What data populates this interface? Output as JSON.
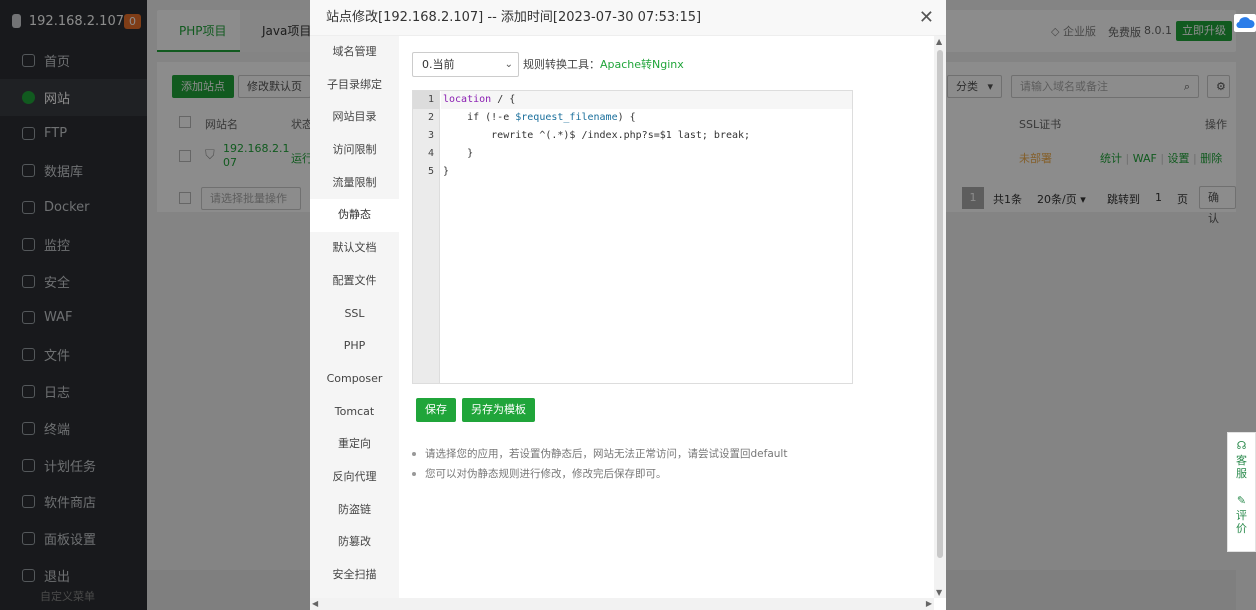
{
  "sidebar": {
    "host": "192.168.2.107",
    "badge": "0",
    "items": [
      {
        "label": "首页"
      },
      {
        "label": "网站"
      },
      {
        "label": "FTP"
      },
      {
        "label": "数据库"
      },
      {
        "label": "Docker"
      },
      {
        "label": "监控"
      },
      {
        "label": "安全"
      },
      {
        "label": "WAF"
      },
      {
        "label": "文件"
      },
      {
        "label": "日志"
      },
      {
        "label": "终端"
      },
      {
        "label": "计划任务"
      },
      {
        "label": "软件商店"
      },
      {
        "label": "面板设置"
      },
      {
        "label": "退出"
      }
    ],
    "footer": "自定义菜单"
  },
  "topbar": {
    "tabs": [
      "PHP项目",
      "Java项目"
    ],
    "enterprise": "企业版",
    "free": "免费版",
    "version": "8.0.1",
    "upgrade": "立即升级"
  },
  "site_list": {
    "add_site": "添加站点",
    "modify_default": "修改默认页",
    "category": "分类",
    "search_placeholder": "请输入域名或备注",
    "col_name": "网站名",
    "col_status": "状态",
    "col_ssl": "SSL证书",
    "col_ops": "操作",
    "row_name": "192.168.2.1\n07",
    "row_status": "运行",
    "row_ssl": "未部署",
    "row_ops": [
      "统计",
      "WAF",
      "设置",
      "删除"
    ],
    "batch_placeholder": "请选择批量操作",
    "pagination": {
      "current": "1",
      "total": "共1条",
      "per_page": "20条/页",
      "goto": "跳转到",
      "page_input": "1",
      "page_unit": "页",
      "confirm": "确认"
    }
  },
  "modal": {
    "title": "站点修改[192.168.2.107] -- 添加时间[2023-07-30 07:53:15]",
    "close": "✕",
    "menu": [
      "域名管理",
      "子目录绑定",
      "网站目录",
      "访问限制",
      "流量限制",
      "伪静态",
      "默认文档",
      "配置文件",
      "SSL",
      "PHP",
      "Composer",
      "Tomcat",
      "重定向",
      "反向代理",
      "防盗链",
      "防篡改",
      "安全扫描"
    ],
    "active_menu": "伪静态",
    "rule_select": "0.当前",
    "tool_label": "规则转换工具：",
    "tool_link": "Apache转Nginx",
    "code_lines": [
      {
        "kw": "location",
        "rest": " / {"
      },
      {
        "pre": "    if (!-e ",
        "var": "$request_filename",
        "rest": ") {"
      },
      {
        "pre": "        rewrite ^(.*)$ /index.php?s=$1 last; break;"
      },
      {
        "pre": "    }"
      },
      {
        "pre": "}"
      }
    ],
    "save": "保存",
    "save_template": "另存为模板",
    "tips": [
      "请选择您的应用，若设置伪静态后，网站无法正常访问，请尝试设置回default",
      "您可以对伪静态规则进行修改，修改完后保存即可。"
    ]
  },
  "dock": {
    "service": "客服",
    "review": "评价"
  }
}
